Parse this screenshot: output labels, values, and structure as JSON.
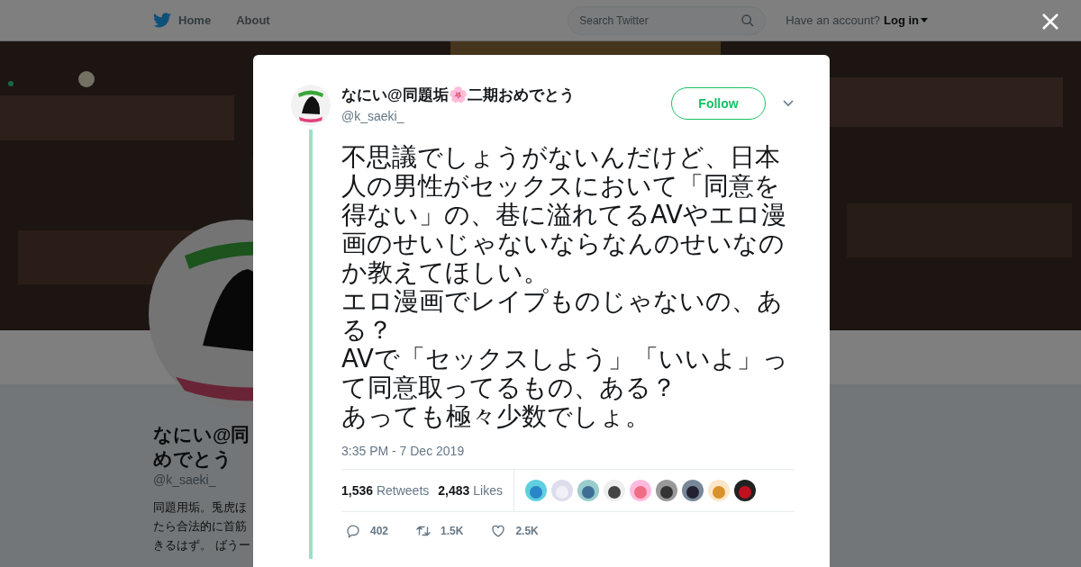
{
  "nav": {
    "items": [
      {
        "label": "Home"
      },
      {
        "label": "About"
      }
    ],
    "search": {
      "placeholder": "Search Twitter"
    },
    "account_prompt": "Have an account?",
    "login": "Log in"
  },
  "profile": {
    "name_lines": [
      "なにい@同",
      "めでとう"
    ],
    "handle": "@k_saeki_",
    "bio_lines": [
      "同題用垢。兎虎ほ",
      "たら合法的に首筋",
      "きるはず。 ばうー"
    ]
  },
  "tweet": {
    "author": "なにい@同題垢🌸二期おめでとう",
    "handle": "@k_saeki_",
    "follow": "Follow",
    "paragraphs": [
      "不思議でしょうがないんだけど、日本人の男性がセックスにおいて「同意を得ない」の、巷に溢れてるAVやエロ漫画のせいじゃないならなんのせいなのか教えてほしい。",
      "エロ漫画でレイプものじゃないの、ある？",
      "AVで「セックスしよう」「いいよ」って同意取ってるもの、ある？",
      "あっても極々少数でしょ。"
    ],
    "time": "3:35 PM - 7 Dec 2019",
    "stats": [
      {
        "count": "1,536",
        "label": "Retweets"
      },
      {
        "count": "2,483",
        "label": "Likes"
      }
    ],
    "actions": [
      {
        "kind": "reply",
        "count": "402"
      },
      {
        "kind": "retweet",
        "count": "1.5K"
      },
      {
        "kind": "like",
        "count": "2.5K"
      }
    ]
  }
}
